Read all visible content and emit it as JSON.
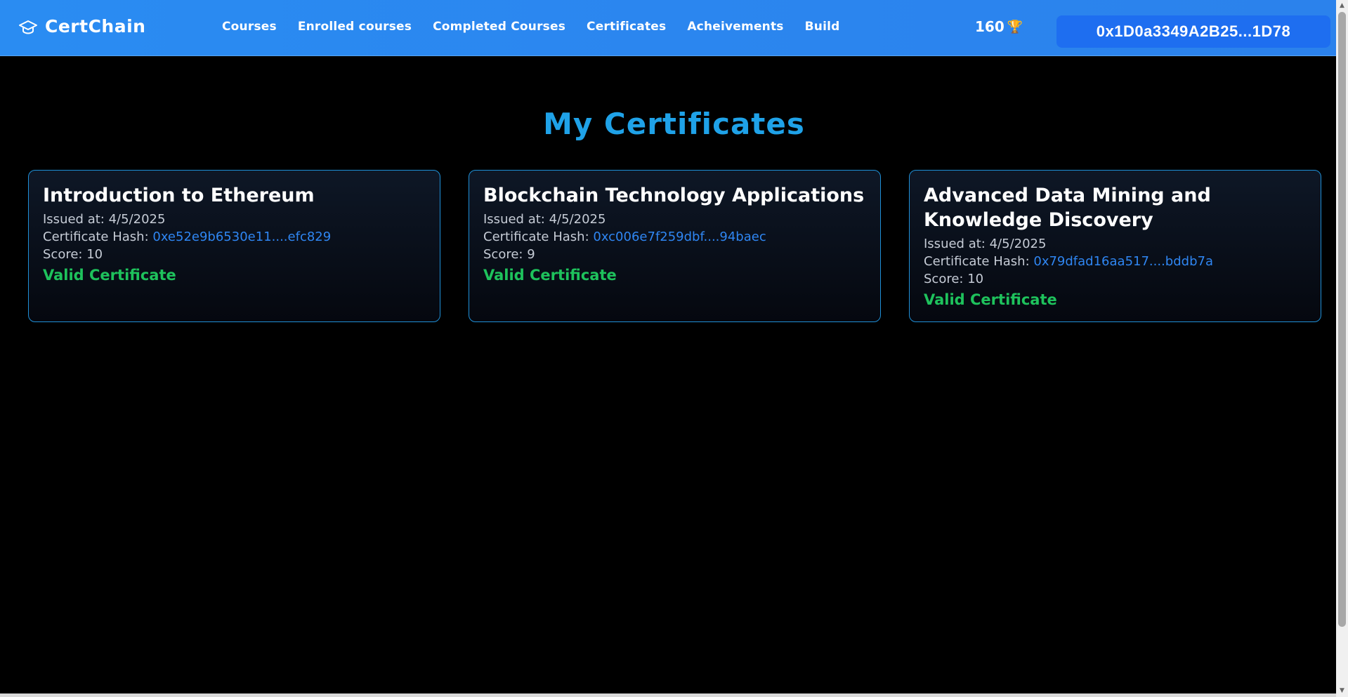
{
  "navbar": {
    "brand": "CertChain",
    "links": [
      "Courses",
      "Enrolled courses",
      "Completed Courses",
      "Certificates",
      "Acheivements",
      "Build"
    ],
    "points": "160",
    "trophy": "🏆",
    "wallet": "0x1D0a3349A2B25...1D78"
  },
  "page": {
    "title": "My Certificates"
  },
  "certificates": [
    {
      "title": "Introduction to Ethereum",
      "issued_label": "Issued at:",
      "issued": "4/5/2025",
      "hash_label": "Certificate Hash:",
      "hash": "0xe52e9b6530e11....efc829",
      "score_label": "Score:",
      "score": "10",
      "status": "Valid Certificate"
    },
    {
      "title": "Blockchain Technology Applications",
      "issued_label": "Issued at:",
      "issued": "4/5/2025",
      "hash_label": "Certificate Hash:",
      "hash": "0xc006e7f259dbf....94baec",
      "score_label": "Score:",
      "score": "9",
      "status": "Valid Certificate"
    },
    {
      "title": "Advanced Data Mining and Knowledge Discovery",
      "issued_label": "Issued at:",
      "issued": "4/5/2025",
      "hash_label": "Certificate Hash:",
      "hash": "0x79dfad16aa517....bddb7a",
      "score_label": "Score:",
      "score": "10",
      "status": "Valid Certificate"
    }
  ],
  "colors": {
    "accent": "#1fa2e8",
    "navbar": "#2a8cf2",
    "valid": "#1ec25c",
    "hash": "#2f86f2"
  }
}
